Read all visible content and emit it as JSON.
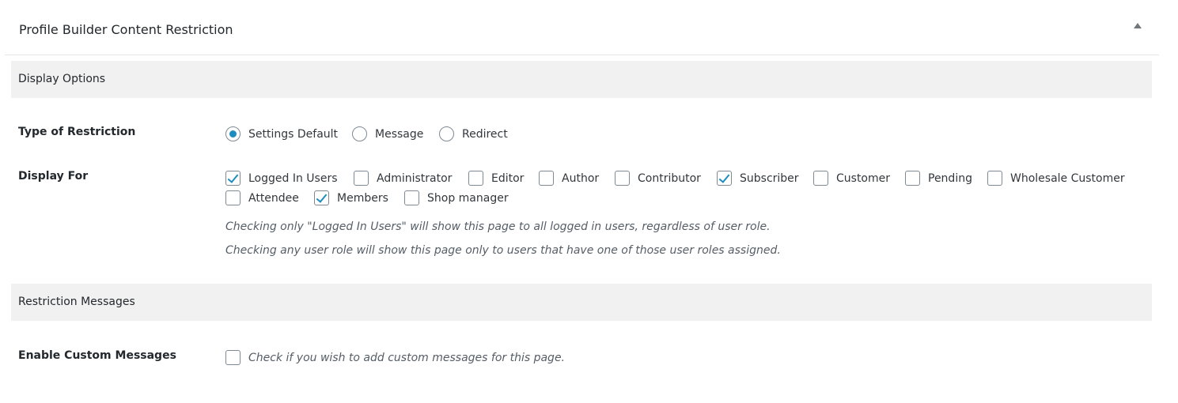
{
  "metabox": {
    "title": "Profile Builder Content Restriction"
  },
  "sections": {
    "display_options": "Display Options",
    "restriction_messages": "Restriction Messages"
  },
  "type_of_restriction": {
    "label": "Type of Restriction",
    "options": [
      {
        "label": "Settings Default",
        "checked": true
      },
      {
        "label": "Message",
        "checked": false
      },
      {
        "label": "Redirect",
        "checked": false
      }
    ]
  },
  "display_for": {
    "label": "Display For",
    "options": [
      {
        "label": "Logged In Users",
        "checked": true
      },
      {
        "label": "Administrator",
        "checked": false
      },
      {
        "label": "Editor",
        "checked": false
      },
      {
        "label": "Author",
        "checked": false
      },
      {
        "label": "Contributor",
        "checked": false
      },
      {
        "label": "Subscriber",
        "checked": true
      },
      {
        "label": "Customer",
        "checked": false
      },
      {
        "label": "Pending",
        "checked": false
      },
      {
        "label": "Wholesale Customer",
        "checked": false
      },
      {
        "label": "Attendee",
        "checked": false
      },
      {
        "label": "Members",
        "checked": true
      },
      {
        "label": "Shop manager",
        "checked": false
      }
    ],
    "help_1": "Checking only \"Logged In Users\" will show this page to all logged in users, regardless of user role.",
    "help_2": "Checking any user role will show this page only to users that have one of those user roles assigned."
  },
  "custom_messages": {
    "label": "Enable Custom Messages",
    "checkbox_label": "Check if you wish to add custom messages for this page.",
    "checked": false
  },
  "colors": {
    "accent": "#1e8cbe",
    "section_bg": "#f1f1f1",
    "text": "#23282d"
  }
}
